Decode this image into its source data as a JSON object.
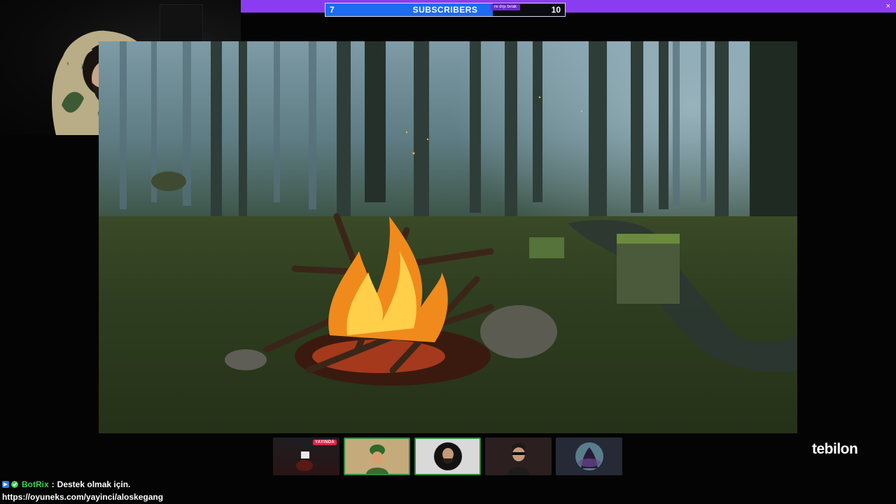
{
  "top_banner": {
    "color": "#8a3df0",
    "close_label": "×"
  },
  "sub_goal": {
    "current": "7",
    "target": "10",
    "label": "SUBSCRIBERS",
    "progress": 0.7,
    "ticker_text": "re dışı bırak",
    "fill_color": "#1d6bf0"
  },
  "brand": {
    "name": "tebilon"
  },
  "thumbnails": [
    {
      "name": "stream-preview-live",
      "badge": "YAYINDA",
      "active": false
    },
    {
      "name": "sultan-avatar",
      "active": true
    },
    {
      "name": "bearded-man-avatar",
      "active": true
    },
    {
      "name": "sunglasses-man-avatar",
      "active": false
    },
    {
      "name": "dark-figure-avatar",
      "active": false
    }
  ],
  "chat": {
    "messages": [
      {
        "icons": [
          "bot-badge-icon",
          "verified-badge-icon"
        ],
        "username": "BotRix",
        "separator": ":",
        "text": "Destek olmak için."
      },
      {
        "text": "https://oyuneks.com/yayinci/aloskegang"
      }
    ]
  }
}
